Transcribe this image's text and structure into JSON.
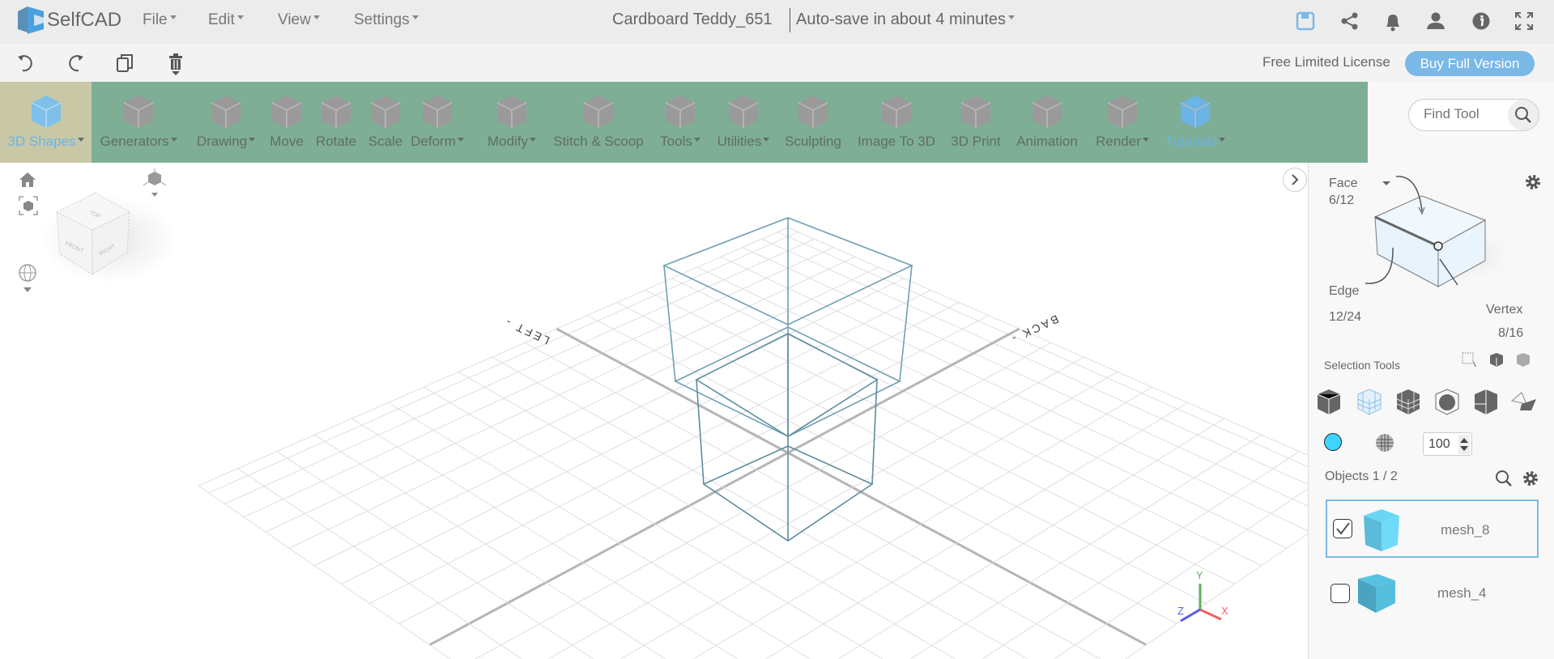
{
  "app": {
    "name": "SelfCAD"
  },
  "header": {
    "menus": [
      "File",
      "Edit",
      "View",
      "Settings"
    ],
    "doc_title": "Cardboard Teddy_651",
    "autosave": "Auto-save in about 4 minutes",
    "icons": [
      "save-icon",
      "share-icon",
      "bell-icon",
      "user-icon",
      "info-icon",
      "fullscreen-icon"
    ]
  },
  "toolbar2": {
    "icons": [
      "undo-icon",
      "redo-icon",
      "copy-icon",
      "delete-icon"
    ],
    "license": "Free Limited License",
    "buy_label": "Buy Full Version"
  },
  "tools": [
    {
      "label": "3D Shapes",
      "dd": true,
      "active": true
    },
    {
      "label": "Generators",
      "dd": true
    },
    {
      "label": "Drawing",
      "dd": true
    },
    {
      "label": "Move"
    },
    {
      "label": "Rotate"
    },
    {
      "label": "Scale"
    },
    {
      "label": "Deform",
      "dd": true
    },
    {
      "label": "Modify",
      "dd": true
    },
    {
      "label": "Stitch & Scoop"
    },
    {
      "label": "Tools",
      "dd": true
    },
    {
      "label": "Utilities",
      "dd": true
    },
    {
      "label": "Sculpting"
    },
    {
      "label": "Image To 3D"
    },
    {
      "label": "3D Print"
    },
    {
      "label": "Animation"
    },
    {
      "label": "Render",
      "dd": true
    },
    {
      "label": "Tutorials",
      "dd": true,
      "link": true
    }
  ],
  "find_tool": {
    "placeholder": "Find Tool"
  },
  "viewport": {
    "labels": {
      "left": "LEFT -",
      "back": "BACK -"
    },
    "viewcube": {
      "top": "TOP",
      "front": "FRONT",
      "right": "RIGHT"
    },
    "axes": {
      "x": "X",
      "y": "Y",
      "z": "Z"
    }
  },
  "panel": {
    "mode": "Face",
    "face_count": "6/12",
    "edge_label": "Edge",
    "edge_count": "12/24",
    "vertex_label": "Vertex",
    "vertex_count": "8/16",
    "selection_tools": "Selection Tools",
    "color": "#3fd4ff",
    "opacity": "100",
    "objects_label": "Objects 1 / 2",
    "objects": [
      {
        "name": "mesh_8",
        "checked": true
      },
      {
        "name": "mesh_4",
        "checked": false
      }
    ]
  },
  "colors": {
    "toolbar_green": "#7fae96",
    "accent": "#7ab8e6"
  }
}
